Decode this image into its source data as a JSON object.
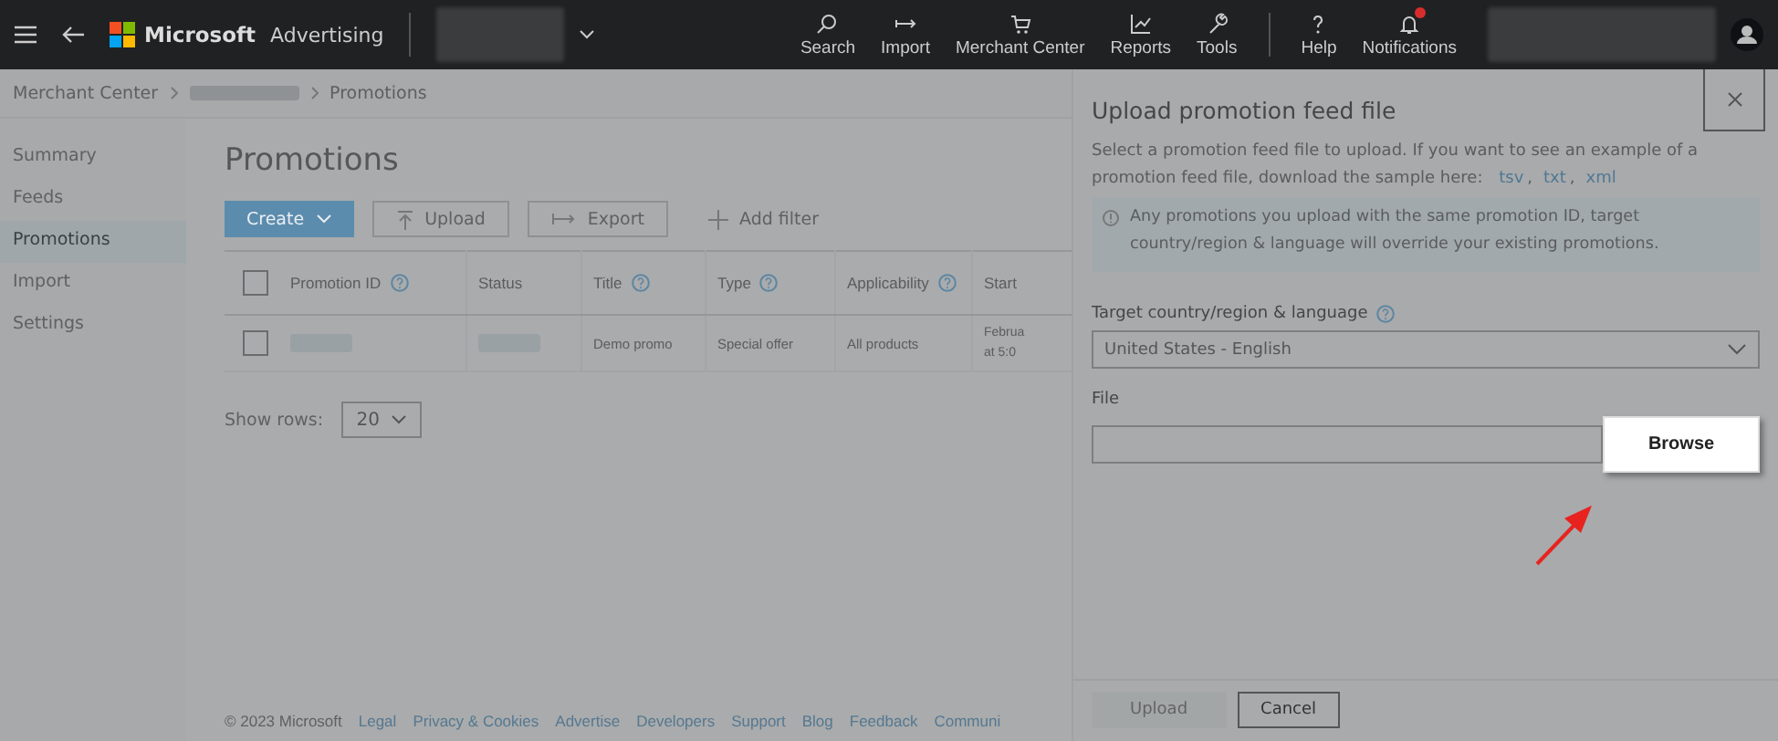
{
  "topbar": {
    "brand_company": "Microsoft",
    "brand_product": "Advertising",
    "nav": [
      {
        "label": "Search"
      },
      {
        "label": "Import"
      },
      {
        "label": "Merchant Center"
      },
      {
        "label": "Reports"
      },
      {
        "label": "Tools"
      }
    ],
    "nav_secondary": [
      {
        "label": "Help",
        "badge": false
      },
      {
        "label": "Notifications",
        "badge": true
      }
    ]
  },
  "breadcrumb": {
    "first": "Merchant Center",
    "last": "Promotions"
  },
  "sidebar": {
    "items": [
      {
        "label": "Summary",
        "selected": false
      },
      {
        "label": "Feeds",
        "selected": false
      },
      {
        "label": "Promotions",
        "selected": true
      },
      {
        "label": "Import",
        "selected": false
      },
      {
        "label": "Settings",
        "selected": false
      }
    ]
  },
  "page": {
    "title": "Promotions",
    "toolbar": {
      "create": "Create",
      "upload": "Upload",
      "export": "Export",
      "add_filter": "Add filter"
    },
    "table": {
      "columns": [
        {
          "label": "Promotion ID",
          "help": true
        },
        {
          "label": "Status",
          "help": false
        },
        {
          "label": "Title",
          "help": true
        },
        {
          "label": "Type",
          "help": true
        },
        {
          "label": "Applicability",
          "help": true
        },
        {
          "label": "Start",
          "help": false
        }
      ],
      "rows": [
        {
          "checked": false,
          "cells": [
            null,
            null,
            "Demo promo",
            "Special offer",
            "All products",
            [
              "Februa",
              "at 5:0"
            ]
          ]
        }
      ],
      "header_checked": false
    },
    "show_rows": {
      "label": "Show rows:",
      "value": "20"
    }
  },
  "footer": [
    "© 2023 Microsoft",
    "Legal",
    "Privacy & Cookies",
    "Advertise",
    "Developers",
    "Support",
    "Blog",
    "Feedback",
    "Communi"
  ],
  "panel": {
    "title": "Upload promotion feed file",
    "intro": "Select a promotion feed file to upload. If you want to see an example of a promotion feed file, download the sample here:",
    "samples": [
      "tsv",
      "txt",
      "xml"
    ],
    "sample_separator": ",",
    "notice": "Any promotions you upload with the same promotion ID, target country/region & language will override your existing promotions.",
    "target_label": "Target country/region & language",
    "target_value": "United States - English",
    "file_label": "File",
    "browse": "Browse",
    "buttons": [
      {
        "label": "Upload",
        "disabled": true
      },
      {
        "label": "Cancel",
        "disabled": false
      }
    ]
  }
}
